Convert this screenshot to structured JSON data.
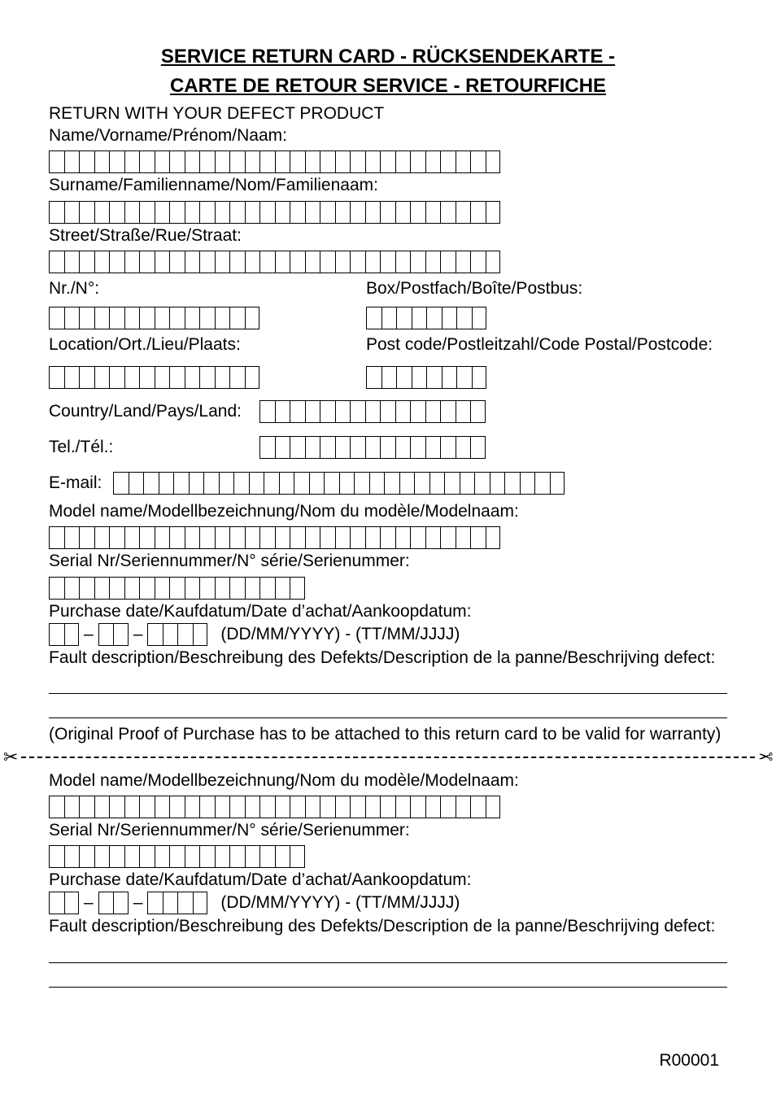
{
  "title_line1": "SERVICE RETURN CARD - RÜCKSENDEKARTE -",
  "title_line2": "CARTE DE RETOUR SERVICE - RETOURFICHE",
  "return_with": "RETURN WITH YOUR DEFECT PRODUCT",
  "labels": {
    "name": "Name/Vorname/Prénom/Naam:",
    "surname": "Surname/Familienname/Nom/Familienaam:",
    "street": "Street/Straße/Rue/Straat:",
    "nr": "Nr./N°:",
    "box": "Box/Postfach/Boîte/Postbus:",
    "location": "Location/Ort./Lieu/Plaats:",
    "postcode": "Post code/Postleitzahl/Code Postal/Postcode:",
    "country": "Country/Land/Pays/Land:",
    "tel": "Tel./Tél.:",
    "email": "E-mail:",
    "model": "Model name/Modellbezeichnung/Nom du modèle/Modelnaam:",
    "serial": "Serial Nr/Seriennummer/N° série/Serienummer:",
    "purchase": "Purchase date/Kaufdatum/Date d’achat/Aankoopdatum:",
    "date_format": "(DD/MM/YYYY) - (TT/MM/JJJJ)",
    "fault": "Fault description/Beschreibung des Defekts/Description de la panne/Beschrijving defect:",
    "proof_note": "(Original Proof of Purchase has to be attached to this return card to be valid for warranty)"
  },
  "box_counts": {
    "name": 30,
    "surname": 30,
    "street": 30,
    "nr": 14,
    "box": 8,
    "location": 14,
    "postcode": 8,
    "country": 15,
    "tel": 15,
    "email": 30,
    "model": 30,
    "serial": 17,
    "date_dd": 2,
    "date_mm": 2,
    "date_yyyy": 4
  },
  "footer_code": "R00001"
}
